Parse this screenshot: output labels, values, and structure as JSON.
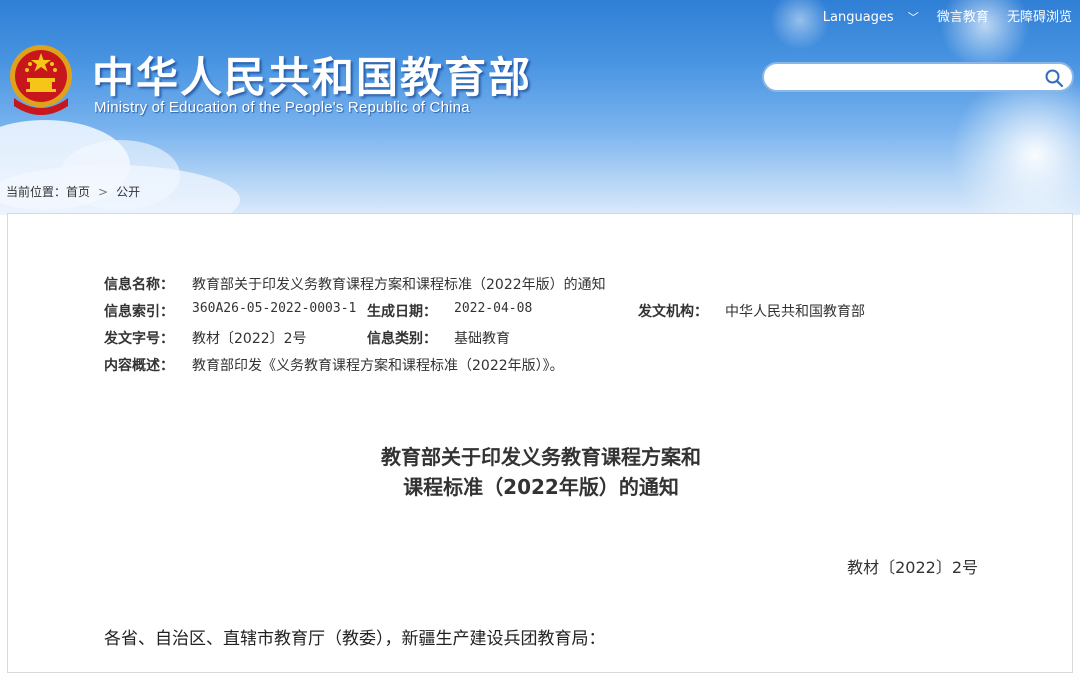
{
  "header": {
    "site_title": "中华人民共和国教育部",
    "site_subtitle": "Ministry of Education of the People's Republic of China",
    "links": {
      "languages": "Languages",
      "weibo": "微言教育",
      "accessibility": "无障碍浏览"
    },
    "search_placeholder": ""
  },
  "breadcrumb": {
    "label": "当前位置：",
    "home": "首页",
    "sep": ">",
    "current": "公开"
  },
  "meta": {
    "name_label": "信息名称：",
    "name_value": "教育部关于印发义务教育课程方案和课程标准（2022年版）的通知",
    "index_label": "信息索引：",
    "index_value": "360A26-05-2022-0003-1",
    "date_label": "生成日期：",
    "date_value": "2022-04-08",
    "org_label": "发文机构：",
    "org_value": "中华人民共和国教育部",
    "docno_label": "发文字号：",
    "docno_value": "教材〔2022〕2号",
    "category_label": "信息类别：",
    "category_value": "基础教育",
    "summary_label": "内容概述：",
    "summary_value": "教育部印发《义务教育课程方案和课程标准（2022年版）》。"
  },
  "document": {
    "title_line1": "教育部关于印发义务教育课程方案和",
    "title_line2": "课程标准（2022年版）的通知",
    "number": "教材〔2022〕2号",
    "salutation": "各省、自治区、直辖市教育厅（教委），新疆生产建设兵团教育局："
  }
}
